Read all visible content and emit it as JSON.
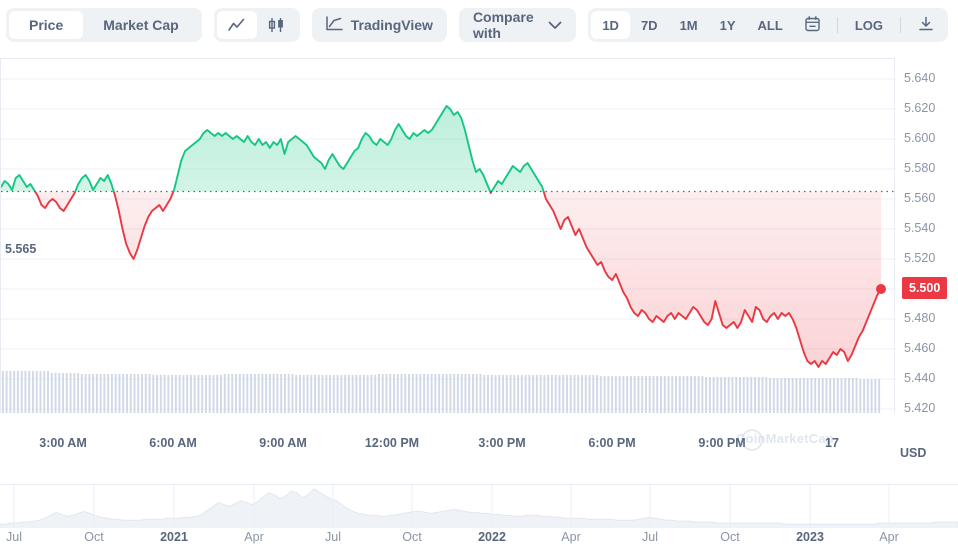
{
  "toolbar": {
    "metric_tabs": [
      {
        "label": "Price",
        "active": true
      },
      {
        "label": "Market Cap",
        "active": false
      }
    ],
    "chart_type_icons": [
      {
        "name": "line-chart-icon",
        "active": true
      },
      {
        "name": "candlestick-chart-icon",
        "active": false
      }
    ],
    "tradingview_label": "TradingView",
    "compare_label": "Compare with",
    "ranges": [
      {
        "label": "1D",
        "active": true
      },
      {
        "label": "7D",
        "active": false
      },
      {
        "label": "1M",
        "active": false
      },
      {
        "label": "1Y",
        "active": false
      },
      {
        "label": "ALL",
        "active": false
      }
    ],
    "calendar_icon": "calendar-icon",
    "log_label": "LOG",
    "download_icon": "download-icon"
  },
  "watermark": "CoinMarketCap",
  "currency": "USD",
  "baseline_label": "5.565",
  "last_price_label": "5.500",
  "chart_data": {
    "type": "line",
    "title": "",
    "xlabel": "",
    "ylabel": "USD",
    "ylim": [
      5.41,
      5.65
    ],
    "y_ticks": [
      "5.640",
      "5.620",
      "5.600",
      "5.580",
      "5.560",
      "5.540",
      "5.520",
      "5.500",
      "5.480",
      "5.460",
      "5.440",
      "5.420"
    ],
    "y_tick_values": [
      5.64,
      5.62,
      5.6,
      5.58,
      5.56,
      5.54,
      5.52,
      5.5,
      5.48,
      5.46,
      5.44,
      5.42
    ],
    "x_ticks": [
      "3:00 AM",
      "6:00 AM",
      "9:00 AM",
      "12:00 PM",
      "3:00 PM",
      "6:00 PM",
      "9:00 PM",
      "17"
    ],
    "baseline": 5.565,
    "last_value": 5.5,
    "grid": true,
    "legend": "none",
    "series": [
      {
        "name": "Price",
        "color_up": "#16c784",
        "color_down": "#ea3943",
        "values": [
          5.568,
          5.572,
          5.57,
          5.566,
          5.574,
          5.576,
          5.572,
          5.568,
          5.57,
          5.566,
          5.562,
          5.556,
          5.554,
          5.558,
          5.56,
          5.558,
          5.554,
          5.552,
          5.556,
          5.56,
          5.564,
          5.57,
          5.574,
          5.576,
          5.572,
          5.566,
          5.57,
          5.574,
          5.572,
          5.576,
          5.57,
          5.562,
          5.552,
          5.54,
          5.53,
          5.524,
          5.52,
          5.526,
          5.534,
          5.542,
          5.548,
          5.552,
          5.554,
          5.556,
          5.552,
          5.556,
          5.56,
          5.566,
          5.576,
          5.586,
          5.592,
          5.594,
          5.596,
          5.598,
          5.6,
          5.604,
          5.606,
          5.604,
          5.602,
          5.604,
          5.602,
          5.604,
          5.602,
          5.6,
          5.602,
          5.6,
          5.598,
          5.602,
          5.598,
          5.596,
          5.6,
          5.596,
          5.598,
          5.594,
          5.598,
          5.596,
          5.6,
          5.59,
          5.598,
          5.6,
          5.602,
          5.6,
          5.598,
          5.596,
          5.592,
          5.588,
          5.586,
          5.584,
          5.58,
          5.586,
          5.59,
          5.586,
          5.582,
          5.58,
          5.584,
          5.588,
          5.592,
          5.594,
          5.6,
          5.604,
          5.602,
          5.598,
          5.596,
          5.6,
          5.598,
          5.596,
          5.6,
          5.606,
          5.61,
          5.606,
          5.602,
          5.6,
          5.604,
          5.602,
          5.604,
          5.606,
          5.604,
          5.606,
          5.61,
          5.614,
          5.618,
          5.622,
          5.62,
          5.616,
          5.618,
          5.614,
          5.606,
          5.596,
          5.586,
          5.578,
          5.58,
          5.576,
          5.57,
          5.564,
          5.568,
          5.572,
          5.57,
          5.574,
          5.578,
          5.582,
          5.58,
          5.578,
          5.582,
          5.584,
          5.58,
          5.576,
          5.572,
          5.568,
          5.56,
          5.556,
          5.552,
          5.546,
          5.54,
          5.546,
          5.548,
          5.542,
          5.536,
          5.54,
          5.534,
          5.528,
          5.524,
          5.52,
          5.516,
          5.518,
          5.512,
          5.508,
          5.506,
          5.51,
          5.504,
          5.498,
          5.494,
          5.488,
          5.484,
          5.482,
          5.486,
          5.484,
          5.48,
          5.478,
          5.482,
          5.48,
          5.478,
          5.482,
          5.484,
          5.48,
          5.484,
          5.482,
          5.48,
          5.484,
          5.488,
          5.486,
          5.482,
          5.478,
          5.476,
          5.48,
          5.492,
          5.484,
          5.476,
          5.474,
          5.476,
          5.478,
          5.474,
          5.478,
          5.486,
          5.482,
          5.478,
          5.488,
          5.486,
          5.48,
          5.478,
          5.482,
          5.484,
          5.48,
          5.484,
          5.482,
          5.484,
          5.48,
          5.474,
          5.466,
          5.458,
          5.452,
          5.45,
          5.452,
          5.448,
          5.452,
          5.45,
          5.454,
          5.458,
          5.456,
          5.46,
          5.458,
          5.452,
          5.456,
          5.462,
          5.468,
          5.472,
          5.478,
          5.484,
          5.49,
          5.496,
          5.5
        ]
      }
    ],
    "volume": {
      "name": "Volume",
      "color": "#c9d2e3",
      "values": [
        42,
        42,
        42,
        42,
        42,
        42,
        42,
        42,
        42,
        42,
        42,
        42,
        42,
        40,
        40,
        40,
        40,
        40,
        40,
        40,
        40,
        39,
        39,
        39,
        39,
        39,
        39,
        39,
        39,
        39,
        39,
        39,
        39,
        39,
        39,
        39,
        39,
        39,
        39,
        39,
        38,
        38,
        38,
        38,
        38,
        38,
        38,
        38,
        38,
        38,
        38,
        38,
        38,
        38,
        38,
        38,
        38,
        38,
        38,
        39,
        39,
        39,
        39,
        39,
        39,
        39,
        39,
        39,
        39,
        39,
        39,
        39,
        39,
        39,
        39,
        39,
        39,
        39,
        38,
        38,
        38,
        38,
        38,
        38,
        38,
        38,
        38,
        38,
        38,
        38,
        38,
        38,
        38,
        38,
        38,
        38,
        38,
        38,
        38,
        38,
        39,
        39,
        39,
        39,
        39,
        39,
        39,
        39,
        39,
        39,
        39,
        39,
        39,
        39,
        39,
        39,
        39,
        39,
        39,
        39,
        39,
        39,
        39,
        39,
        39,
        39,
        39,
        39,
        38,
        38,
        38,
        38,
        38,
        38,
        38,
        38,
        38,
        38,
        38,
        38,
        38,
        38,
        38,
        38,
        38,
        38,
        38,
        38,
        38,
        38,
        38,
        38,
        38,
        38,
        38,
        38,
        38,
        38,
        38,
        37,
        37,
        37,
        37,
        37,
        37,
        37,
        37,
        37,
        37,
        37,
        37,
        37,
        37,
        37,
        37,
        37,
        37,
        37,
        37,
        37,
        37,
        37,
        37,
        37,
        37,
        37,
        37,
        36,
        36,
        36,
        36,
        36,
        36,
        36,
        36,
        36,
        36,
        36,
        36,
        36,
        36,
        36,
        36,
        36,
        35,
        35,
        35,
        35,
        35,
        35,
        35,
        35,
        35,
        35,
        35,
        35,
        35,
        35,
        35,
        35,
        35,
        35,
        35,
        35,
        35,
        35,
        35,
        35,
        34,
        34,
        34,
        34,
        34,
        34
      ]
    }
  },
  "navigator": {
    "x_ticks": [
      {
        "label": "Jul",
        "year": false
      },
      {
        "label": "Oct",
        "year": false
      },
      {
        "label": "2021",
        "year": true
      },
      {
        "label": "Apr",
        "year": false
      },
      {
        "label": "Jul",
        "year": false
      },
      {
        "label": "Oct",
        "year": false
      },
      {
        "label": "2022",
        "year": true
      },
      {
        "label": "Apr",
        "year": false
      },
      {
        "label": "Jul",
        "year": false
      },
      {
        "label": "Oct",
        "year": false
      },
      {
        "label": "2023",
        "year": true
      },
      {
        "label": "Apr",
        "year": false
      }
    ],
    "area_values": [
      4,
      4,
      5,
      5,
      6,
      6,
      7,
      8,
      10,
      13,
      16,
      14,
      12,
      13,
      15,
      17,
      15,
      13,
      11,
      10,
      9,
      9,
      8,
      8,
      8,
      8,
      9,
      9,
      9,
      9,
      10,
      10,
      10,
      11,
      11,
      12,
      14,
      18,
      22,
      26,
      24,
      22,
      25,
      28,
      26,
      24,
      27,
      32,
      36,
      34,
      30,
      33,
      38,
      36,
      31,
      34,
      40,
      37,
      33,
      30,
      28,
      24,
      20,
      17,
      15,
      14,
      13,
      13,
      12,
      12,
      13,
      14,
      15,
      16,
      17,
      17,
      16,
      15,
      16,
      17,
      18,
      19,
      18,
      17,
      16,
      16,
      15,
      15,
      14,
      14,
      13,
      13,
      12,
      12,
      13,
      13,
      13,
      12,
      12,
      11,
      11,
      10,
      10,
      10,
      10,
      9,
      9,
      9,
      9,
      9,
      8,
      8,
      8,
      8,
      9,
      10,
      11,
      10,
      9,
      8,
      8,
      7,
      7,
      7,
      6,
      6,
      6,
      6,
      5,
      5,
      5,
      5,
      5,
      5,
      5,
      5,
      5,
      5,
      5,
      5,
      4,
      4,
      4,
      4,
      4,
      4,
      4,
      4,
      4,
      4,
      4,
      4,
      4,
      4,
      4,
      4,
      4,
      5,
      5,
      5,
      5,
      5,
      5,
      5,
      5,
      5,
      5,
      6,
      6,
      6,
      6,
      6
    ]
  }
}
